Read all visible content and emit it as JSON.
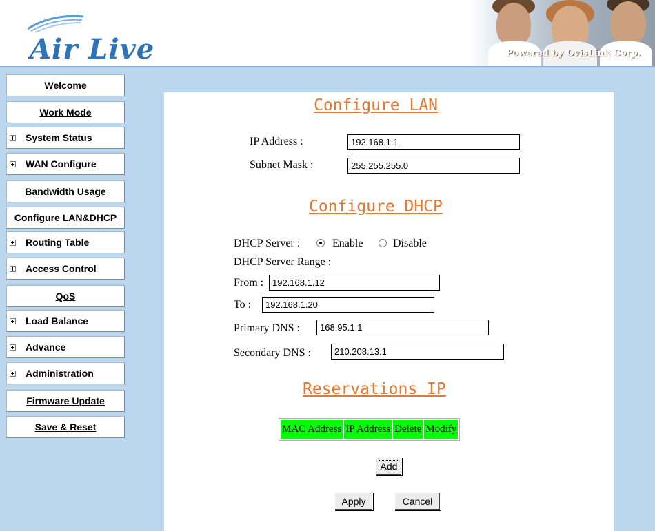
{
  "header": {
    "brand": "Air Live",
    "powered_by": "Powered by OvisLink Corp."
  },
  "sidebar": {
    "items": [
      {
        "label": "Welcome",
        "kind": "link"
      },
      {
        "label": "Work Mode",
        "kind": "link"
      },
      {
        "label": "System Status",
        "kind": "expand"
      },
      {
        "label": "WAN Configure",
        "kind": "expand"
      },
      {
        "label": "Bandwidth Usage",
        "kind": "link"
      },
      {
        "label": "Configure LAN&DHCP",
        "kind": "link",
        "active": true
      },
      {
        "label": "Routing Table",
        "kind": "expand"
      },
      {
        "label": "Access Control",
        "kind": "expand"
      },
      {
        "label": "QoS",
        "kind": "link"
      },
      {
        "label": "Load Balance",
        "kind": "expand"
      },
      {
        "label": "Advance",
        "kind": "expand"
      },
      {
        "label": "Administration",
        "kind": "expand"
      },
      {
        "label": "Firmware Update",
        "kind": "link"
      },
      {
        "label": "Save & Reset",
        "kind": "link"
      }
    ]
  },
  "lan": {
    "title": "Configure LAN",
    "ip_label": "IP Address :",
    "ip_value": "192.168.1.1",
    "mask_label": "Subnet Mask :",
    "mask_value": "255.255.255.0"
  },
  "dhcp": {
    "title": "Configure DHCP",
    "server_label": "DHCP Server :",
    "enable_label": "Enable",
    "disable_label": "Disable",
    "selected": "Enable",
    "range_label": "DHCP Server Range :",
    "from_label": "From :",
    "from_value": "192.168.1.12",
    "to_label": "To :",
    "to_value": "192.168.1.20",
    "primary_dns_label": "Primary DNS :",
    "primary_dns_value": "168.95.1.1",
    "secondary_dns_label": "Secondary DNS :",
    "secondary_dns_value": "210.208.13.1"
  },
  "reservations": {
    "title": "Reservations IP",
    "columns": [
      "MAC Address",
      "IP Address",
      "Delete",
      "Modify"
    ],
    "header_color": "#00ff00",
    "add_label": "Add"
  },
  "actions": {
    "apply_label": "Apply",
    "cancel_label": "Cancel"
  },
  "colors": {
    "background": "#bcd6ee",
    "title_accent": "#e8772e",
    "brand_blue": "#2f72b8"
  }
}
